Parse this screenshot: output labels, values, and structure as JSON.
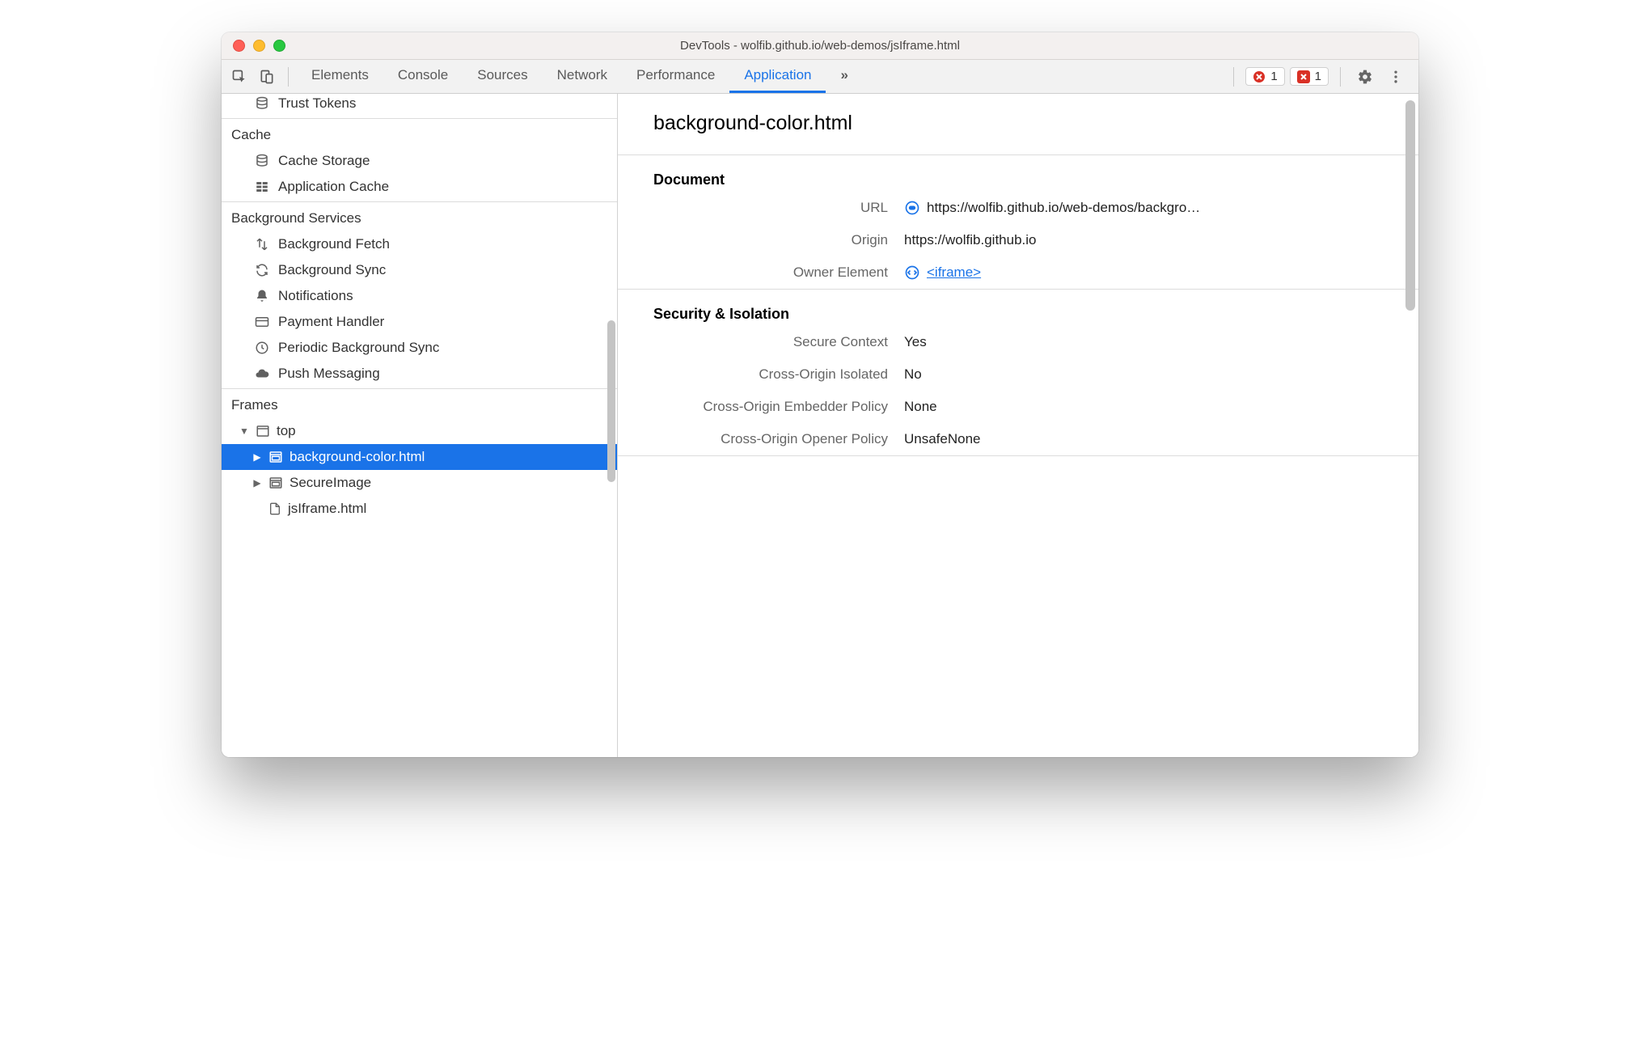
{
  "window": {
    "title": "DevTools - wolfib.github.io/web-demos/jsIframe.html"
  },
  "tabs": {
    "items": [
      "Elements",
      "Console",
      "Sources",
      "Network",
      "Performance",
      "Application"
    ],
    "active": "Application"
  },
  "right": {
    "error_count": "1",
    "issue_count": "1"
  },
  "sidebar": {
    "trust_tokens": "Trust Tokens",
    "cache_header": "Cache",
    "cache_storage": "Cache Storage",
    "application_cache": "Application Cache",
    "bg_header": "Background Services",
    "bg_fetch": "Background Fetch",
    "bg_sync": "Background Sync",
    "notifications": "Notifications",
    "payment": "Payment Handler",
    "periodic": "Periodic Background Sync",
    "push": "Push Messaging",
    "frames_header": "Frames",
    "top": "top",
    "frame_bg": "background-color.html",
    "frame_secure": "SecureImage",
    "frame_js": "jsIframe.html"
  },
  "main": {
    "title": "background-color.html",
    "doc_header": "Document",
    "url_label": "URL",
    "url_value": "https://wolfib.github.io/web-demos/backgro…",
    "origin_label": "Origin",
    "origin_value": "https://wolfib.github.io",
    "owner_label": "Owner Element",
    "owner_value": "<iframe>",
    "sec_header": "Security & Isolation",
    "secure_context_label": "Secure Context",
    "secure_context_value": "Yes",
    "coi_label": "Cross-Origin Isolated",
    "coi_value": "No",
    "coep_label": "Cross-Origin Embedder Policy",
    "coep_value": "None",
    "coop_label": "Cross-Origin Opener Policy",
    "coop_value": "UnsafeNone"
  }
}
